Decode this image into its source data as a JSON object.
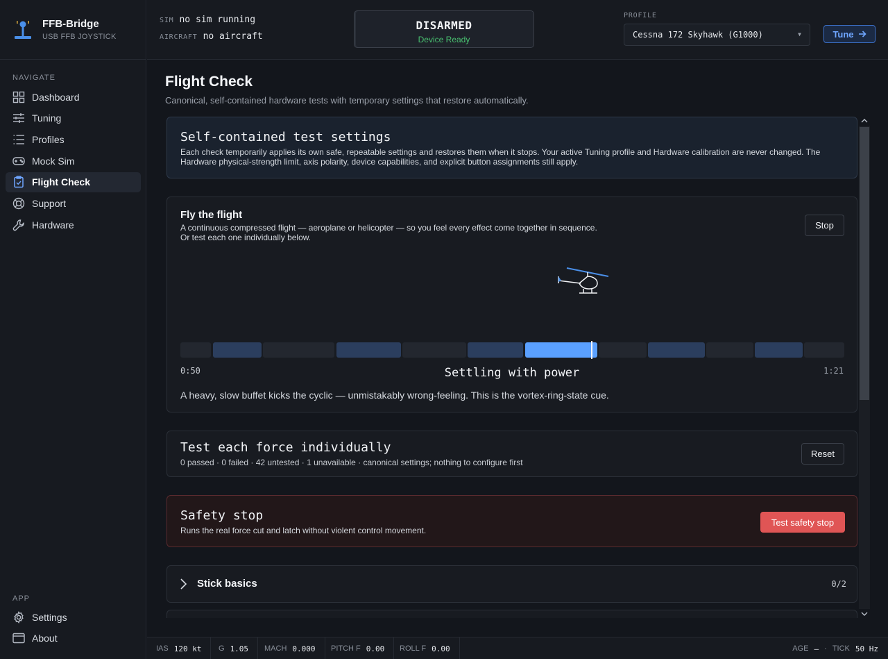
{
  "brand": {
    "title": "FFB-Bridge",
    "subtitle": "USB FFB JOYSTICK"
  },
  "sidebar": {
    "navigate_label": "NAVIGATE",
    "items": [
      {
        "label": "Dashboard",
        "icon": "dashboard-icon"
      },
      {
        "label": "Tuning",
        "icon": "sliders-icon"
      },
      {
        "label": "Profiles",
        "icon": "list-icon"
      },
      {
        "label": "Mock Sim",
        "icon": "gamepad-icon"
      },
      {
        "label": "Flight Check",
        "icon": "clipboard-check-icon",
        "active": true
      },
      {
        "label": "Support",
        "icon": "lifebuoy-icon"
      },
      {
        "label": "Hardware",
        "icon": "wrench-icon"
      }
    ],
    "app_label": "APP",
    "app_items": [
      {
        "label": "Settings",
        "icon": "gear-icon"
      },
      {
        "label": "About",
        "icon": "window-icon"
      }
    ]
  },
  "header": {
    "sim_key": "SIM",
    "sim_value": "no sim running",
    "aircraft_key": "AIRCRAFT",
    "aircraft_value": "no aircraft",
    "status_main": "DISARMED",
    "status_sub": "Device Ready",
    "profile_label": "PROFILE",
    "profile_value": "Cessna 172 Skyhawk (G1000)",
    "tune_label": "Tune"
  },
  "page": {
    "title": "Flight Check",
    "subtitle": "Canonical, self-contained hardware tests with temporary settings that restore automatically."
  },
  "info_card": {
    "title": "Self-contained test settings",
    "body": "Each check temporarily applies its own safe, repeatable settings and restores them when it stops. Your active Tuning profile and Hardware calibration are never changed. The Hardware physical-strength limit, axis polarity, device capabilities, and explicit button assignments still apply."
  },
  "fly_card": {
    "title": "Fly the flight",
    "desc_line1": "A continuous compressed flight — aeroplane or helicopter — so you feel every effect come together in sequence.",
    "desc_line2": "Or test each one individually below.",
    "stop_label": "Stop",
    "time_current": "0:50",
    "time_total": "1:21",
    "phase_title": "Settling with power",
    "phase_desc": "A heavy, slow buffet kicks the cyclic — unmistakably wrong-feeling. This is the vortex-ring-state cue.",
    "playhead_fraction": 0.62
  },
  "test_card": {
    "title": "Test each force individually",
    "summary": "0 passed · 0 failed · 42 untested · 1 unavailable · canonical settings; nothing to configure first",
    "reset_label": "Reset"
  },
  "safety_card": {
    "title": "Safety stop",
    "desc": "Runs the real force cut and latch without violent control movement.",
    "button_label": "Test safety stop"
  },
  "stick_card": {
    "title": "Stick basics",
    "count": "0/2"
  },
  "footer": {
    "ias_key": "IAS",
    "ias_value": "120 kt",
    "g_key": "G",
    "g_value": "1.05",
    "mach_key": "MACH",
    "mach_value": "0.000",
    "pitch_key": "PITCH F",
    "pitch_value": "0.00",
    "roll_key": "ROLL F",
    "roll_value": "0.00",
    "age_key": "AGE",
    "age_value": "—",
    "sep": "·",
    "tick_key": "TICK",
    "tick_value": "50 Hz"
  },
  "colors": {
    "accent": "#5aa0ff",
    "ready": "#49c070",
    "danger": "#e05555"
  }
}
